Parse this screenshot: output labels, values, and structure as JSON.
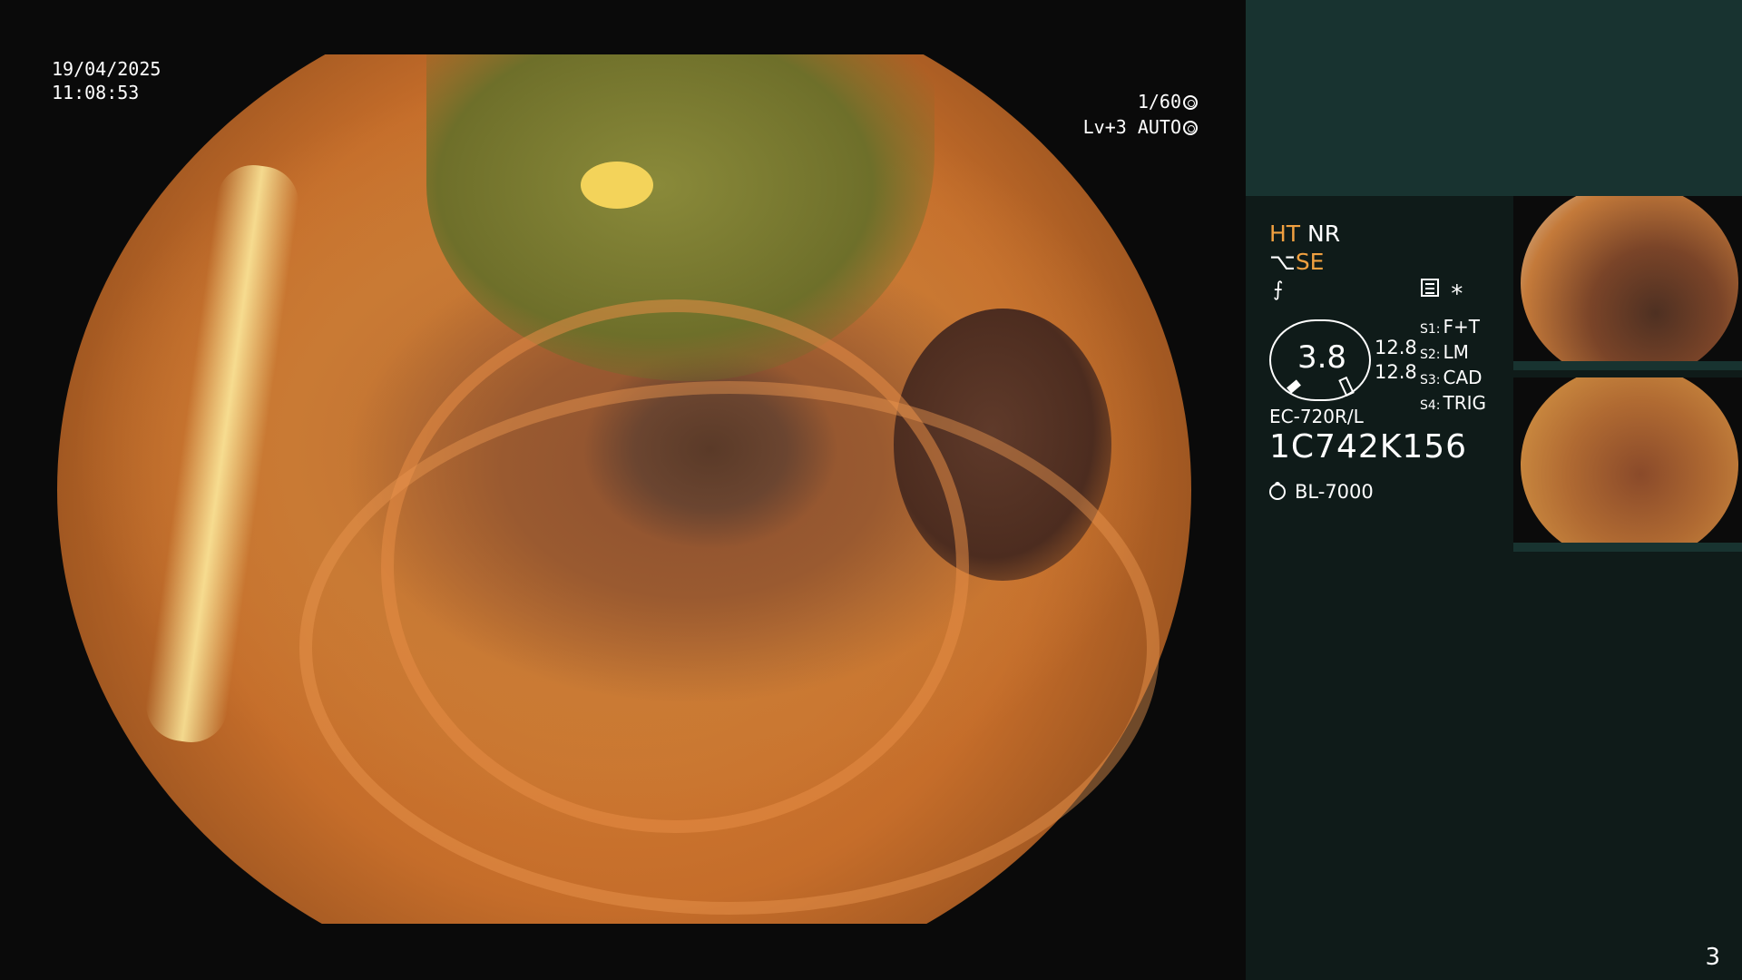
{
  "overlay": {
    "date": "19/04/2025",
    "time": "11:08:53",
    "shutter": "1/60",
    "level": "Lv+3",
    "mode": "AUTO"
  },
  "panel": {
    "mode_line1": [
      "HT",
      "NR"
    ],
    "mode_line2": "SE",
    "gauge_value": "3.8",
    "gain_values": [
      "12.8",
      "12.8"
    ],
    "switches": [
      {
        "label": "S1:",
        "value": "F+T"
      },
      {
        "label": "S2:",
        "value": "LM"
      },
      {
        "label": "S3:",
        "value": "CAD"
      },
      {
        "label": "S4:",
        "value": "TRIG"
      }
    ],
    "scope_model": "EC-720R/L",
    "serial": "1C742K156",
    "light_source": "BL-7000",
    "page_number": "3"
  },
  "colors": {
    "panel_bg": "#0f1b19",
    "panel_header": "#183330",
    "accent_orange": "#f0a040"
  }
}
